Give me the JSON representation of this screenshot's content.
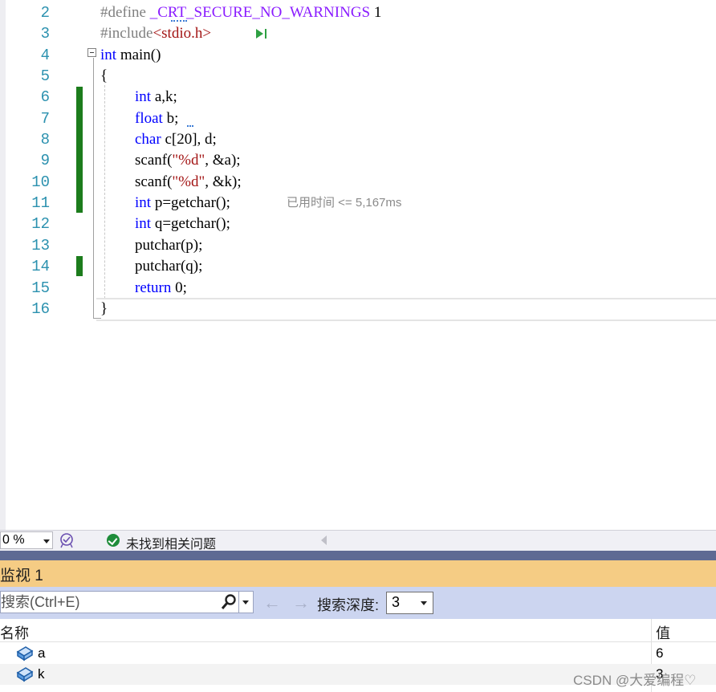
{
  "editor": {
    "line_numbers": [
      "2",
      "3",
      "4",
      "5",
      "6",
      "7",
      "8",
      "9",
      "10",
      "11",
      "12",
      "13",
      "14",
      "15",
      "16"
    ],
    "lines": {
      "l2_directive": "#define",
      "l2_macro": "_CRT_SECURE_NO_WARNINGS",
      "l2_value": "1",
      "l3_directive": "#include",
      "l3_header": "<stdio.h>",
      "l4_type": "int",
      "l4_rest": "main()",
      "l5": "{",
      "l6_type": "int",
      "l6_rest": "a,k;",
      "l7_type": "float",
      "l7_rest": "b;",
      "l8_type": "char",
      "l8_rest": "c[20], d;",
      "l9_fn": "scanf(",
      "l9_str": "\"%d\"",
      "l9_rest": ", &a);",
      "l10_fn": "scanf(",
      "l10_str": "\"%d\"",
      "l10_rest": ", &k);",
      "l11_type": "int",
      "l11_rest": "p=getchar();",
      "l12_type": "int",
      "l12_rest": "q=getchar();",
      "l13": "putchar(p);",
      "l14": "putchar(q);",
      "l15_kw": "return",
      "l15_rest": "0;",
      "l16": "}"
    },
    "perf_tip": "已用时间 <= 5,167ms",
    "colors": {
      "keyword": "#0000ff",
      "line_number": "#2b91af",
      "string": "#a31515",
      "macro": "#8a1bff",
      "change_bar": "#1c7c1c"
    }
  },
  "statusbar": {
    "zoom": "0 %",
    "issues_text": "未找到相关问题",
    "icons": {
      "health": "intellicode-icon",
      "ok": "check-circle-icon"
    }
  },
  "watch": {
    "title": "监视 1",
    "search_placeholder": "搜索(Ctrl+E)",
    "depth_label": "搜索深度:",
    "depth_value": "3",
    "columns": {
      "name": "名称",
      "value": "值"
    },
    "rows": [
      {
        "name": "a",
        "value": "6"
      },
      {
        "name": "k",
        "value": "3"
      }
    ]
  },
  "watermark": "CSDN @大爱编程♡"
}
